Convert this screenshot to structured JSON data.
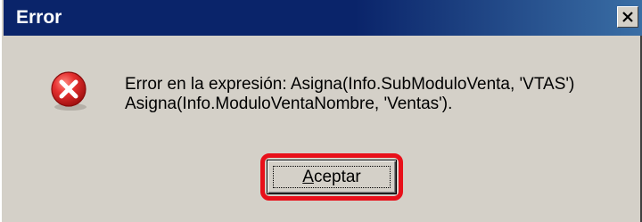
{
  "dialog": {
    "title": "Error",
    "message_line1": "Error en la expresión: Asigna(Info.SubModuloVenta, 'VTAS')",
    "message_line2": "Asigna(Info.ModuloVentaNombre, 'Ventas').",
    "ok_button": {
      "accelerator": "A",
      "rest": "ceptar"
    },
    "icons": {
      "message": "error-icon",
      "close": "close-icon"
    },
    "colors": {
      "title_bar": "#0a246a",
      "title_bar_fade": "#3a6ea5",
      "window_face": "#d4d0c8",
      "highlight_annotation": "#e8101a",
      "error_icon": "#d42020"
    }
  }
}
